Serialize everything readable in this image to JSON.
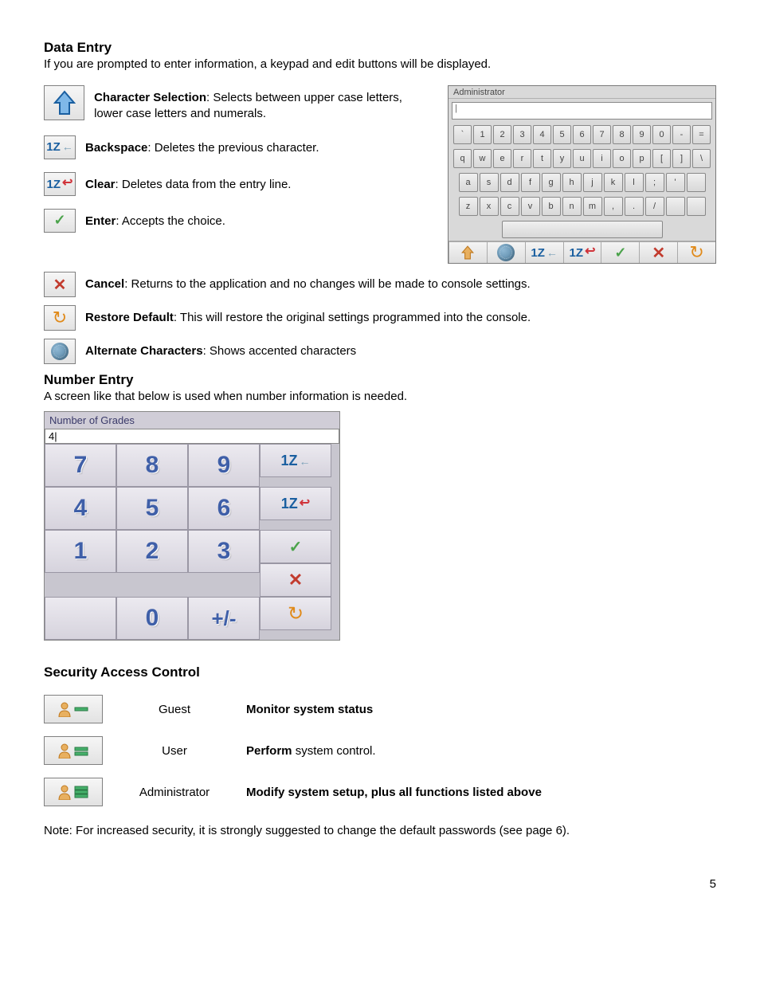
{
  "section_data_entry": {
    "title": "Data Entry",
    "intro": "If you are prompted to enter information, a keypad and edit buttons will be displayed.",
    "legend": {
      "char_sel": {
        "label": "Character Selection",
        "desc": ": Selects between upper case letters, lower case letters and numerals."
      },
      "backspace": {
        "label": "Backspace",
        "desc": ": Deletes the previous character."
      },
      "clear": {
        "label": "Clear",
        "desc": ": Deletes data from the entry line."
      },
      "enter": {
        "label": "Enter",
        "desc": ": Accepts the choice."
      },
      "cancel": {
        "label": "Cancel",
        "desc": ": Returns to the application and no changes will be made to console settings."
      },
      "restore": {
        "label": "Restore Default",
        "desc": ": This will restore the original settings programmed into the console."
      },
      "alt": {
        "label": "Alternate Characters",
        "desc": ":  Shows accented characters"
      }
    }
  },
  "qwerty": {
    "title": "Administrator",
    "input_value": "|",
    "row1": [
      "`",
      "1",
      "2",
      "3",
      "4",
      "5",
      "6",
      "7",
      "8",
      "9",
      "0",
      "-",
      "="
    ],
    "row2": [
      "q",
      "w",
      "e",
      "r",
      "t",
      "y",
      "u",
      "i",
      "o",
      "p",
      "[",
      "]",
      "\\"
    ],
    "row3": [
      "a",
      "s",
      "d",
      "f",
      "g",
      "h",
      "j",
      "k",
      "l",
      ";",
      "'",
      ""
    ],
    "row4": [
      "z",
      "x",
      "c",
      "v",
      "b",
      "n",
      "m",
      ",",
      ".",
      "/",
      "",
      ""
    ]
  },
  "section_number_entry": {
    "title": "Number Entry",
    "intro": "A screen like that below is used when number information is needed."
  },
  "numpad": {
    "title": "Number of Grades",
    "input_value": "4|",
    "keys": [
      "7",
      "8",
      "9",
      "4",
      "5",
      "6",
      "1",
      "2",
      "3",
      "",
      "0",
      "+/-"
    ]
  },
  "section_security": {
    "title": "Security Access Control",
    "rows": {
      "guest": {
        "role": "Guest",
        "perm_bold": "Monitor system status",
        "perm_rest": ""
      },
      "user": {
        "role": "User",
        "perm_bold": "Perform",
        "perm_rest": " system control."
      },
      "admin": {
        "role": "Administrator",
        "perm_bold": "Modify system setup, plus all functions listed above",
        "perm_rest": ""
      }
    },
    "note": "Note: For increased security, it is strongly suggested to change the default passwords (see page 6)."
  },
  "page_number": "5"
}
